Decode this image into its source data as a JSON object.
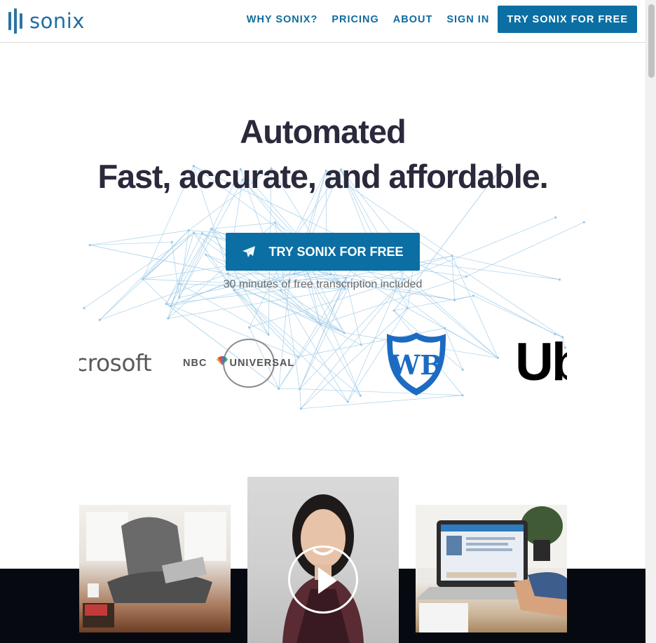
{
  "header": {
    "logo_text": "sonix",
    "nav": {
      "why": "WHY SONIX?",
      "pricing": "PRICING",
      "about": "ABOUT",
      "sign_in": "SIGN IN",
      "cta": "TRY SONIX FOR FREE"
    }
  },
  "hero": {
    "title_line1": "Automated",
    "title_line2": "Fast, accurate, and affordable.",
    "cta_label": "TRY SONIX FOR FREE",
    "cta_icon": "paper-plane-icon",
    "subtitle": "30 minutes of free transcription included"
  },
  "client_logos": {
    "microsoft": "crosoft",
    "nbc_left": "NBC",
    "nbc_right": "UNIVERSAL",
    "uber": "Ub"
  },
  "media": {
    "left_photo": "person-laptop-photo",
    "video_icon": "play-icon",
    "right_photo": "laptop-screen-photo"
  },
  "colors": {
    "brand": "#0b6fa4",
    "heading": "#2b2a3c",
    "muted": "#6b6b6b",
    "dark_band": "#060a10"
  }
}
